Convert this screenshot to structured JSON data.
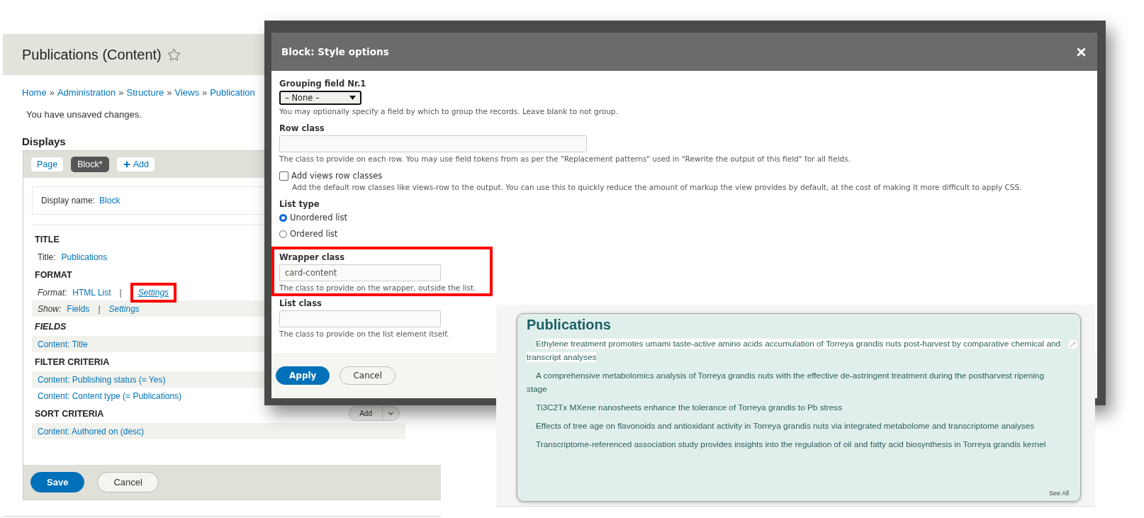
{
  "admin": {
    "title": "Publications (Content)",
    "breadcrumb": {
      "separator": "»",
      "links": [
        "Home",
        "Administration",
        "Structure",
        "Views",
        "Publication"
      ]
    },
    "message": "You have unsaved changes.",
    "displays_heading": "Displays",
    "tabs": [
      {
        "label": "Page",
        "selected": false
      },
      {
        "label": "Block*",
        "selected": true
      }
    ],
    "add_tab": "Add",
    "display_name": {
      "label": "Display name:",
      "value": "Block"
    },
    "sections": [
      {
        "heading": "TITLE",
        "italic": false,
        "rows": [
          {
            "label": "Title:",
            "italic": false,
            "shaded": false,
            "links": [
              {
                "text": "Publications",
                "highlighted": false
              }
            ]
          }
        ]
      },
      {
        "heading": "FORMAT",
        "italic": false,
        "rows": [
          {
            "label": "Format:",
            "italic": true,
            "shaded": false,
            "separator": "|",
            "links": [
              {
                "text": "HTML List",
                "highlighted": false
              },
              {
                "text": "Settings",
                "highlighted": true
              }
            ]
          },
          {
            "label": "Show:",
            "italic": true,
            "shaded": true,
            "separator": "|",
            "links": [
              {
                "text": "Fields",
                "highlighted": false
              },
              {
                "text": "Settings",
                "highlighted": false
              }
            ]
          }
        ]
      },
      {
        "heading": "FIELDS",
        "italic": true,
        "rows": [
          {
            "shaded": true,
            "links": [
              {
                "text": "Content: Title",
                "highlighted": false
              }
            ]
          }
        ]
      },
      {
        "heading": "FILTER CRITERIA",
        "italic": false,
        "rows": [
          {
            "shaded": true,
            "links": [
              {
                "text": "Content: Publishing status (= Yes)",
                "highlighted": false
              }
            ]
          },
          {
            "shaded": false,
            "links": [
              {
                "text": "Content: Content type (= Publications)",
                "highlighted": false
              }
            ]
          }
        ]
      },
      {
        "heading": "SORT CRITERIA",
        "italic": false,
        "action": "Add",
        "rows": [
          {
            "shaded": true,
            "links": [
              {
                "text": "Content: Authored on (desc)",
                "highlighted": false
              }
            ]
          }
        ]
      }
    ],
    "buttons": [
      {
        "label": "Save",
        "kind": "primary"
      },
      {
        "label": "Cancel",
        "kind": "secondary"
      }
    ]
  },
  "dialog": {
    "title": "Block: Style options",
    "fields": [
      {
        "kind": "select",
        "label": "Grouping field Nr.1",
        "value": "– None –",
        "description": "You may optionally specify a field by which to group the records. Leave blank to not group.",
        "highlighted": false
      },
      {
        "kind": "wide_text",
        "label": "Row class",
        "description": "The class to provide on each row. You may use field tokens from as per the \"Replacement patterns\" used in \"Rewrite the output of this field\" for all fields.",
        "highlighted": false
      },
      {
        "kind": "checkbox",
        "label": "Add views row classes",
        "checked": false,
        "description": "Add the default row classes like views-row to the output. You can use this to quickly reduce the amount of markup the view provides by default, at the cost of making it more difficult to apply CSS.",
        "highlighted": false
      },
      {
        "kind": "radios",
        "label": "List type",
        "options": [
          {
            "label": "Unordered list",
            "selected": true
          },
          {
            "label": "Ordered list",
            "selected": false
          }
        ],
        "highlighted": false
      },
      {
        "kind": "text",
        "label": "Wrapper class",
        "value": "card-content",
        "description": "The class to provide on the wrapper, outside the list.",
        "highlighted": true
      },
      {
        "kind": "text",
        "label": "List class",
        "description": "The class to provide on the list element itself.",
        "highlighted": false
      }
    ],
    "buttons": [
      {
        "label": "Apply",
        "kind": "primary"
      },
      {
        "label": "Cancel",
        "kind": "secondary"
      }
    ]
  },
  "preview": {
    "title": "Publications",
    "items": [
      {
        "text": "Ethylene treatment promotes umami taste-active amino acids accumulation of Torreya grandis nuts post-harvest by comparative chemical and transcript analyses",
        "highlighted": true
      },
      {
        "text": "A comprehensive metabolomics analysis of Torreya grandis nuts with the effective de-astringent treatment during the postharvest ripening stage",
        "highlighted": false
      },
      {
        "text": "Ti3C2Tx MXene nanosheets enhance the tolerance of Torreya grandis to Pb stress",
        "highlighted": false
      },
      {
        "text": "Effects of tree age on flavonoids and antioxidant activity in Torreya grandis nuts via integrated metabolome and transcriptome analyses",
        "highlighted": false
      },
      {
        "text": "Transcriptome-referenced association study provides insights into the regulation of oil and fatty acid biosynthesis in Torreya grandis kernel",
        "highlighted": false
      }
    ],
    "see_all": "See All"
  }
}
